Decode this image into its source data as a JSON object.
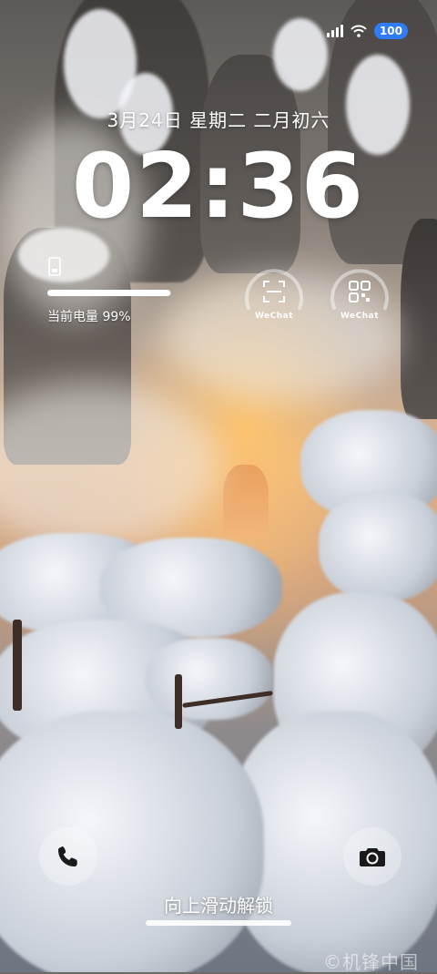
{
  "status_bar": {
    "signal_icon": "signal-icon",
    "wifi_icon": "wifi-icon",
    "battery_level": "100",
    "battery_badge_color": "#2f7cf6"
  },
  "lockscreen": {
    "date_line": "3月24日 星期二 二月初六",
    "time": "02:36"
  },
  "battery_widget": {
    "icon": "phone-battery-icon",
    "label": "当前电量 99%",
    "level": 0.99
  },
  "widgets": [
    {
      "label": "WeChat",
      "icon": "scan-icon"
    },
    {
      "label": "WeChat",
      "icon": "qr-code-icon"
    }
  ],
  "quick_actions": {
    "left_icon": "phone-icon",
    "right_icon": "camera-icon"
  },
  "unlock_hint": "向上滑动解锁",
  "watermark": "©机锋中国"
}
